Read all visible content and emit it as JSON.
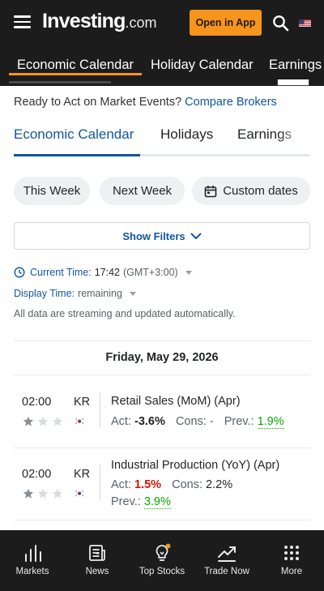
{
  "header": {
    "logo_main": "Investing",
    "logo_suffix": ".com",
    "open_app_label": "Open in App",
    "search_icon": "search-icon",
    "menu_icon": "hamburger-menu-icon",
    "flag_icon": "us-flag-icon",
    "accent_color": "#f7941d"
  },
  "top_nav": {
    "tabs": [
      {
        "label": "Economic Calendar",
        "active": true
      },
      {
        "label": "Holiday Calendar",
        "active": false
      },
      {
        "label": "Earnings",
        "active": false
      }
    ]
  },
  "promo": {
    "text": "Ready to Act on Market Events?",
    "link": "Compare Brokers"
  },
  "sub_tabs": {
    "tabs": [
      {
        "label": "Economic Calendar",
        "active": true
      },
      {
        "label": "Holidays",
        "active": false
      },
      {
        "label": "Earnings",
        "active": false
      }
    ]
  },
  "date_filters": {
    "this_week": "This Week",
    "next_week": "Next Week",
    "custom": "Custom dates"
  },
  "filters_label": "Show Filters",
  "time_info": {
    "current_label": "Current Time:",
    "current_value": "17:42",
    "timezone": "(GMT+3:00)",
    "display_label": "Display Time:",
    "display_value": "remaining",
    "note": "All data are streaming and updated automatically."
  },
  "date_heading": "Friday, May 29, 2026",
  "events": [
    {
      "time": "02:00",
      "country": "KR",
      "flag_icon": "south-korea-flag-icon",
      "importance": 1,
      "name": "Retail Sales (MoM) (Apr)",
      "act_label": "Act:",
      "act_value": "-3.6%",
      "cons_label": "Cons:",
      "cons_value": "-",
      "prev_label": "Prev.:",
      "prev_value": "1.9%"
    },
    {
      "time": "02:00",
      "country": "KR",
      "flag_icon": "south-korea-flag-icon",
      "importance": 1,
      "name": "Industrial Production (YoY) (Apr)",
      "act_label": "Act:",
      "act_value": "1.5%",
      "cons_label": "Cons:",
      "cons_value": "2.2%",
      "prev_label": "Prev.:",
      "prev_value": "3.9%"
    }
  ],
  "bottom_nav": {
    "items": [
      {
        "label": "Markets",
        "icon": "markets-bar-chart-icon"
      },
      {
        "label": "News",
        "icon": "news-icon"
      },
      {
        "label": "Top Stocks",
        "icon": "lightbulb-icon"
      },
      {
        "label": "Trade Now",
        "icon": "trend-up-icon"
      },
      {
        "label": "More",
        "icon": "grid-dots-icon"
      }
    ]
  }
}
